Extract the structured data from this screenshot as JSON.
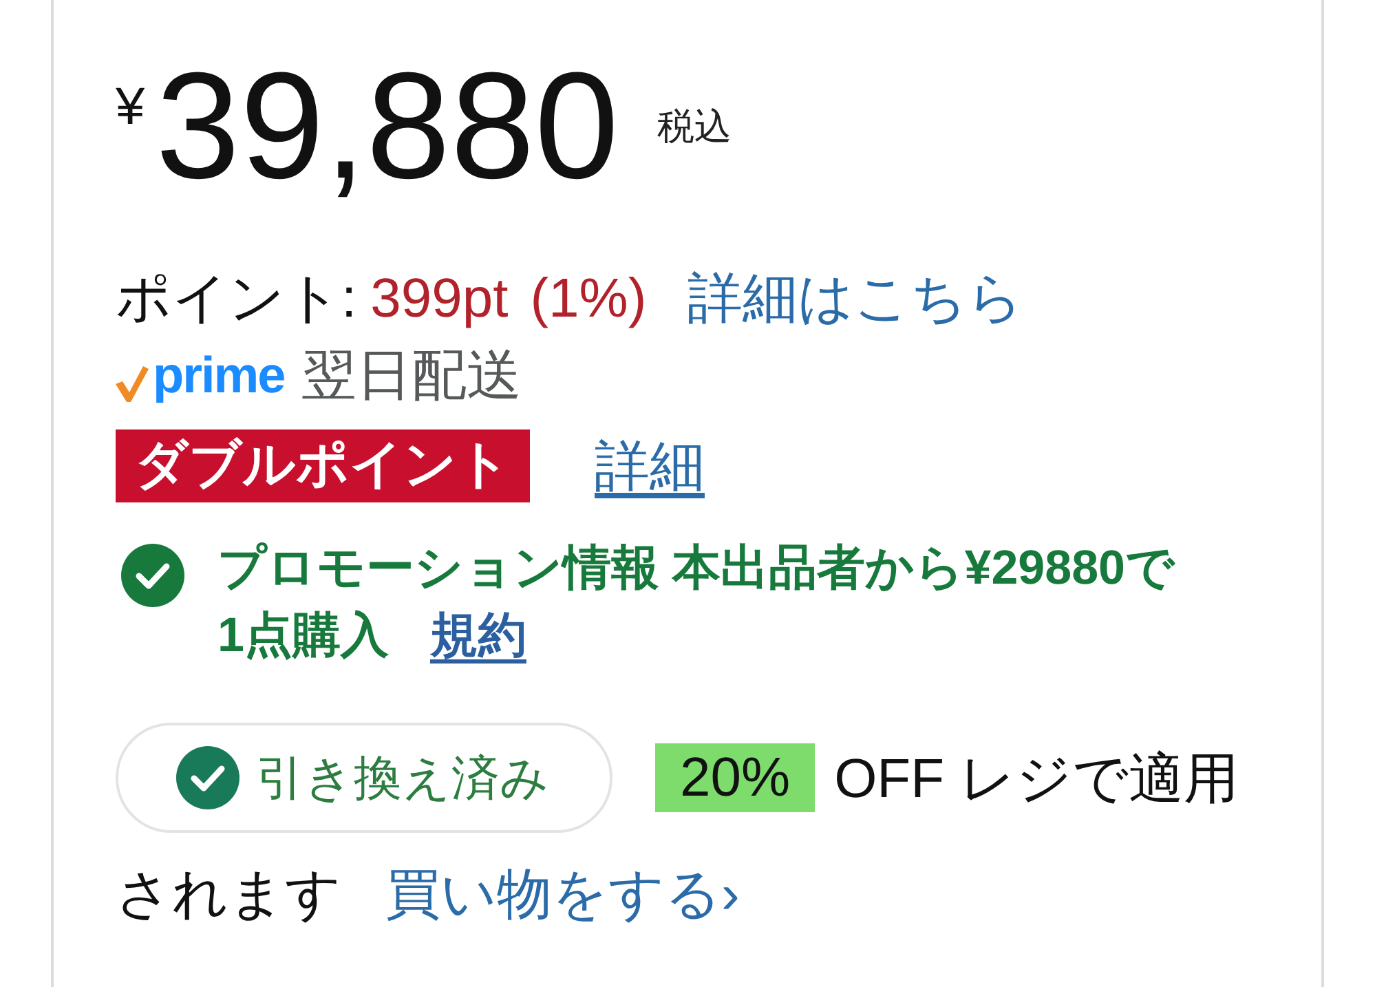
{
  "price": {
    "currency": "¥",
    "amount": "39,880",
    "tax_note": "税込"
  },
  "points": {
    "label": "ポイント:",
    "value": "399pt",
    "rate": "(1%)",
    "link": "詳細はこちら"
  },
  "delivery": {
    "logo_text": "prime",
    "text": "翌日配送"
  },
  "campaign": {
    "badge": "ダブルポイント",
    "link": "詳細"
  },
  "promotion": {
    "lines": [
      "プロモーション情報 本出品者から¥29880で",
      "1点購入"
    ],
    "link": "規約"
  },
  "coupon": {
    "button": {
      "label": "引き換え済み",
      "redeemed": true
    },
    "discount": "20%",
    "lines": [
      "OFF レジで適用",
      "されます"
    ],
    "link": "買い物をする›"
  }
}
